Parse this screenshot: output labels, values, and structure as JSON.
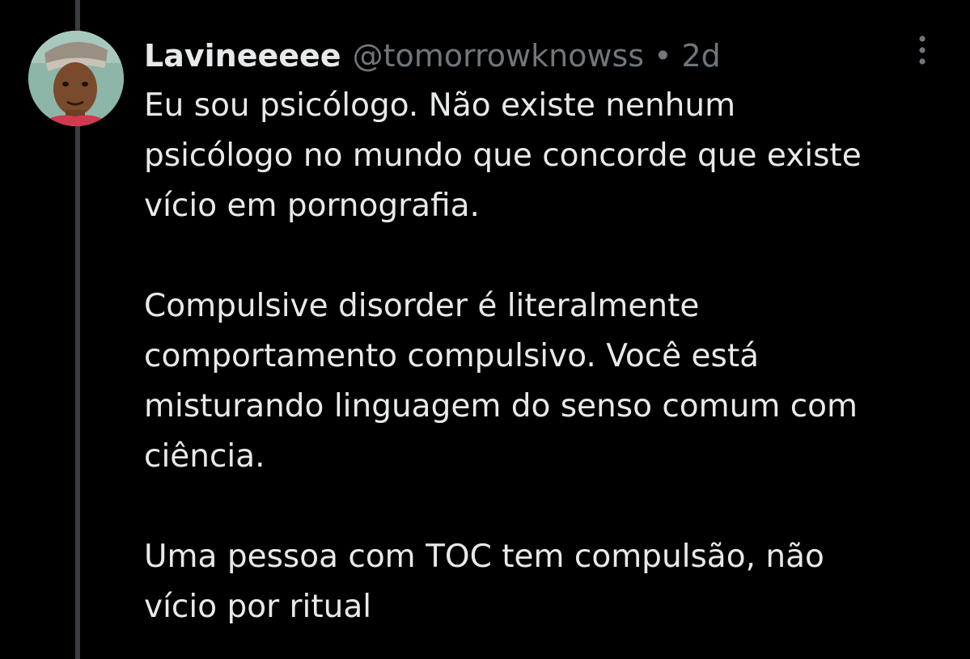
{
  "tweet": {
    "author": {
      "display_name": "Lavineeeee",
      "handle": "@tomorrowknowss",
      "avatar_icon": "profile-photo"
    },
    "separator": "•",
    "time": "2d",
    "more_icon": "vertical-ellipsis-icon",
    "paragraphs": [
      "Eu sou psicólogo. Não existe nenhum\npsicólogo no mundo que concorde que existe\nvício em pornografia.",
      "Compulsive disorder é literalmente\ncomportamento compulsivo. Você está\nmisturando linguagem do senso comum com\nciência.",
      "Uma pessoa com TOC tem compulsão, não\nvício por ritual"
    ]
  },
  "colors": {
    "background": "#000000",
    "text_primary": "#e7e9ea",
    "text_secondary": "#71767b",
    "thread_line": "#3a3d40"
  }
}
